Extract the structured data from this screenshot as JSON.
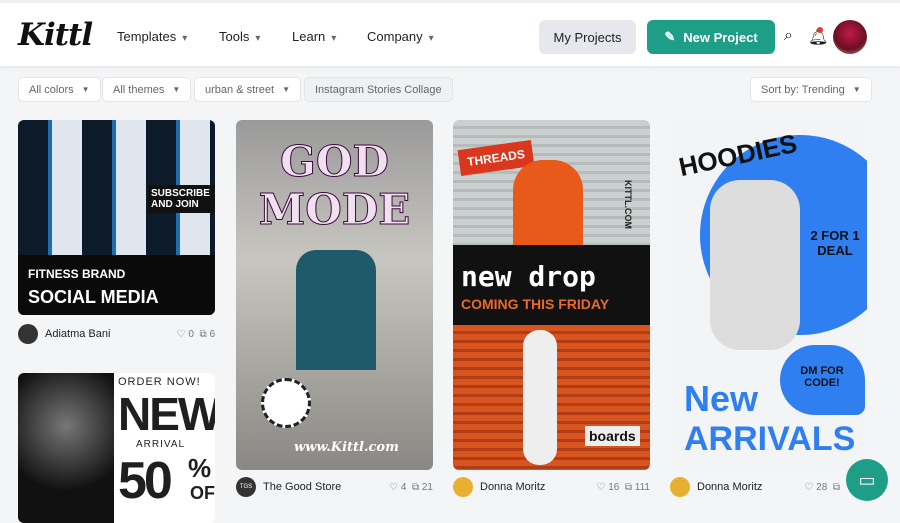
{
  "header": {
    "logo": "Kittl",
    "nav": [
      "Templates",
      "Tools",
      "Learn",
      "Company"
    ],
    "my_projects": "My Projects",
    "new_project": "New Project",
    "chevron": "⌄"
  },
  "filters": {
    "colors": "All colors",
    "themes": "All themes",
    "style": "urban & street",
    "category": "Instagram Stories Collage",
    "sort": "Sort by: Trending"
  },
  "colors": {
    "accent": "#1e9e87",
    "notification": "#e53935"
  },
  "cards": [
    {
      "author": "Adiatma Bani",
      "likes": "0",
      "uses": "6",
      "texts": [
        "FITNESS BRAND",
        "SOCIAL MEDIA",
        "SUBSCRIBE AND JOIN"
      ]
    },
    {
      "author": "The Good Store",
      "avatar": "TGS",
      "likes": "4",
      "uses": "21",
      "texts": [
        "GOD MODE",
        "www.Kittl.com"
      ]
    },
    {
      "author": "Donna Moritz",
      "likes": "16",
      "uses": "111",
      "texts": [
        "THREADS",
        "new drop",
        "COMING THIS FRIDAY",
        "KITTL.COM",
        "boards"
      ]
    },
    {
      "author": "Donna Moritz",
      "likes": "28",
      "uses": "",
      "texts": [
        "HOODIES",
        "2 FOR 1 DEAL",
        "DM FOR CODE!",
        "New",
        "ARRIVALS"
      ]
    },
    {
      "texts": [
        "ORDER NOW!",
        "NEW",
        "ARRIVAL",
        "50",
        "%",
        "OFF"
      ]
    }
  ]
}
